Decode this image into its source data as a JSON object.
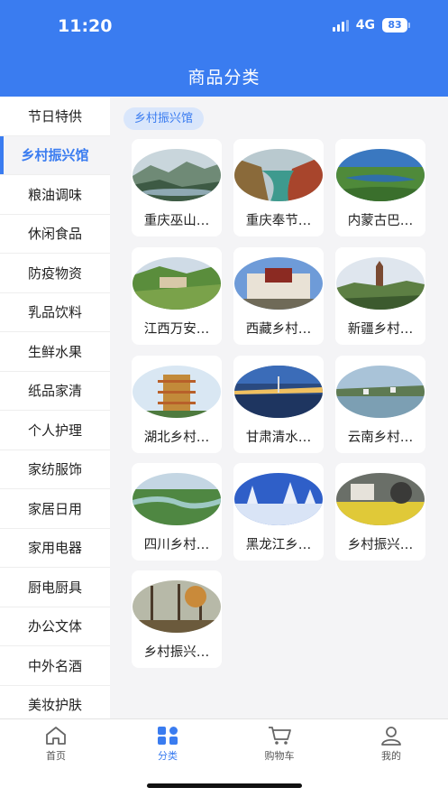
{
  "status_bar": {
    "time": "11:20",
    "network": "4G",
    "battery": "83"
  },
  "header": {
    "title": "商品分类"
  },
  "sidebar": {
    "items": [
      {
        "label": "节日特供"
      },
      {
        "label": "乡村振兴馆",
        "active": true
      },
      {
        "label": "粮油调味"
      },
      {
        "label": "休闲食品"
      },
      {
        "label": "防疫物资"
      },
      {
        "label": "乳品饮料"
      },
      {
        "label": "生鲜水果"
      },
      {
        "label": "纸品家清"
      },
      {
        "label": "个人护理"
      },
      {
        "label": "家纺服饰"
      },
      {
        "label": "家居日用"
      },
      {
        "label": "家用电器"
      },
      {
        "label": "厨电厨具"
      },
      {
        "label": "办公文体"
      },
      {
        "label": "中外名酒"
      },
      {
        "label": "美妆护肤"
      }
    ]
  },
  "content": {
    "section_tag": "乡村振兴馆",
    "cards": [
      {
        "label": "重庆巫山…",
        "image": "misty-mountain-river-photo"
      },
      {
        "label": "重庆奉节…",
        "image": "river-gorge-photo"
      },
      {
        "label": "内蒙古巴…",
        "image": "grassland-lake-photo"
      },
      {
        "label": "江西万安…",
        "image": "mountain-village-photo"
      },
      {
        "label": "西藏乡村…",
        "image": "potala-palace-photo"
      },
      {
        "label": "新疆乡村…",
        "image": "pagoda-landscape-photo"
      },
      {
        "label": "湖北乡村…",
        "image": "yellow-crane-tower-photo"
      },
      {
        "label": "甘肃清水…",
        "image": "bridge-night-photo"
      },
      {
        "label": "云南乡村…",
        "image": "lake-village-photo"
      },
      {
        "label": "四川乡村…",
        "image": "river-bend-photo"
      },
      {
        "label": "黑龙江乡…",
        "image": "snow-forest-photo"
      },
      {
        "label": "乡村振兴…",
        "image": "rapeseed-field-photo"
      },
      {
        "label": "乡村振兴…",
        "image": "autumn-trees-photo"
      }
    ]
  },
  "tabbar": {
    "items": [
      {
        "label": "首页",
        "icon": "home-icon"
      },
      {
        "label": "分类",
        "icon": "category-icon",
        "active": true
      },
      {
        "label": "购物车",
        "icon": "cart-icon"
      },
      {
        "label": "我的",
        "icon": "user-icon"
      }
    ]
  },
  "colors": {
    "accent": "#3a7cf0",
    "tag_bg": "#d9e6fb",
    "page_bg": "#f4f4f6"
  }
}
